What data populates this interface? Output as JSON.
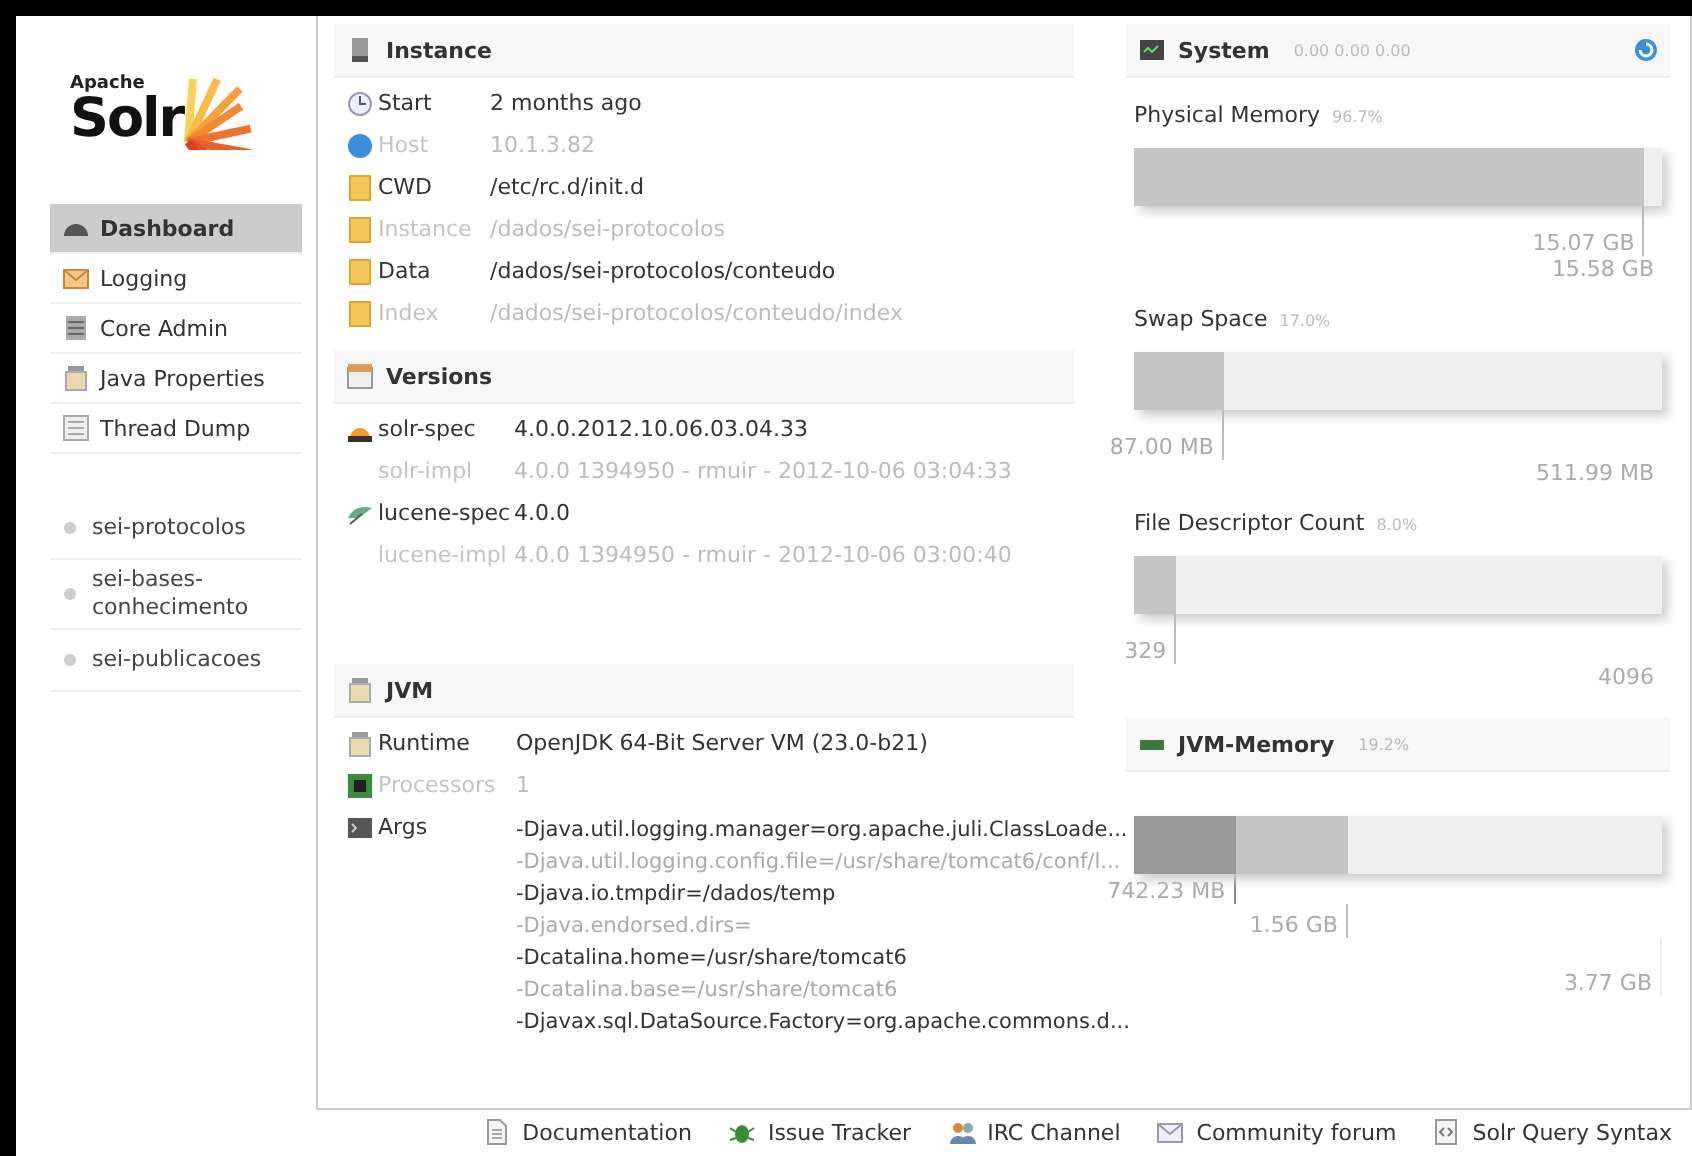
{
  "logo": {
    "small": "Apache",
    "large": "Solr"
  },
  "menu": [
    {
      "label": "Dashboard",
      "selected": true
    },
    {
      "label": "Logging",
      "selected": false
    },
    {
      "label": "Core Admin",
      "selected": false
    },
    {
      "label": "Java Properties",
      "selected": false
    },
    {
      "label": "Thread Dump",
      "selected": false
    }
  ],
  "cores": [
    {
      "label": "sei-protocolos",
      "selected": false
    },
    {
      "label": "sei-bases-conhecimento",
      "selected": false
    },
    {
      "label": "sei-publicacoes",
      "selected": false
    }
  ],
  "instance": {
    "title": "Instance",
    "rows": [
      {
        "label": "Start",
        "value": "2 months ago",
        "dim": false
      },
      {
        "label": "Host",
        "value": "10.1.3.82",
        "dim": true
      },
      {
        "label": "CWD",
        "value": "/etc/rc.d/init.d",
        "dim": false
      },
      {
        "label": "Instance",
        "value": "/dados/sei-protocolos",
        "dim": true
      },
      {
        "label": "Data",
        "value": "/dados/sei-protocolos/conteudo",
        "dim": false
      },
      {
        "label": "Index",
        "value": "/dados/sei-protocolos/conteudo/index",
        "dim": true
      }
    ]
  },
  "versions": {
    "title": "Versions",
    "rows": [
      {
        "label": "solr-spec",
        "value": "4.0.0.2012.10.06.03.04.33",
        "dim": false
      },
      {
        "label": "solr-impl",
        "value": "4.0.0 1394950 - rmuir - 2012-10-06 03:04:33",
        "dim": true
      },
      {
        "label": "lucene-spec",
        "value": "4.0.0",
        "dim": false
      },
      {
        "label": "lucene-impl",
        "value": "4.0.0 1394950 - rmuir - 2012-10-06 03:00:40",
        "dim": true
      }
    ]
  },
  "jvm": {
    "title": "JVM",
    "rows": [
      {
        "label": "Runtime",
        "value": "OpenJDK 64-Bit Server VM (23.0-b21)",
        "dim": false
      },
      {
        "label": "Processors",
        "value": "1",
        "dim": true
      }
    ],
    "args": {
      "label": "Args",
      "lines": [
        {
          "text": "-Djava.util.logging.manager=org.apache.juli.ClassLoade...",
          "dim": false
        },
        {
          "text": "-Djava.util.logging.config.file=/usr/share/tomcat6/conf/l...",
          "dim": true
        },
        {
          "text": "-Djava.io.tmpdir=/dados/temp",
          "dim": false
        },
        {
          "text": "-Djava.endorsed.dirs=",
          "dim": true
        },
        {
          "text": "-Dcatalina.home=/usr/share/tomcat6",
          "dim": false
        },
        {
          "text": "-Dcatalina.base=/usr/share/tomcat6",
          "dim": true
        },
        {
          "text": "-Djavax.sql.DataSource.Factory=org.apache.commons.d...",
          "dim": false
        }
      ]
    }
  },
  "system": {
    "title": "System",
    "load": "0.00  0.00  0.00",
    "meters": [
      {
        "label": "Physical Memory",
        "percent": "96.7%",
        "level": 0.967,
        "used": "15.07 GB",
        "total": "15.58 GB"
      },
      {
        "label": "Swap Space",
        "percent": "17.0%",
        "level": 0.17,
        "used": "87.00 MB",
        "total": "511.99 MB"
      },
      {
        "label": "File Descriptor Count",
        "percent": "8.0%",
        "level": 0.08,
        "used": "329",
        "total": "4096"
      }
    ]
  },
  "jvm_memory": {
    "title": "JVM-Memory",
    "percent": "19.2%",
    "used": {
      "level": 0.192,
      "value": "742.23 MB"
    },
    "committed": {
      "level": 0.405,
      "value": "1.56 GB"
    },
    "max": "3.77 GB"
  },
  "footer": [
    {
      "label": "Documentation"
    },
    {
      "label": "Issue Tracker"
    },
    {
      "label": "IRC Channel"
    },
    {
      "label": "Community forum"
    },
    {
      "label": "Solr Query Syntax"
    }
  ]
}
